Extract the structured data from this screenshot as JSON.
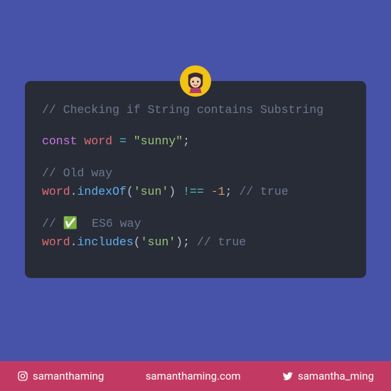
{
  "code": {
    "title_comment": "// Checking if String contains Substring",
    "const_kw": "const",
    "var_name": "word",
    "assign_op": "=",
    "string_value": "\"sunny\"",
    "semicolon": ";",
    "old_comment": "// Old way",
    "dot": ".",
    "indexof_fn": "indexOf",
    "open_paren": "(",
    "arg_sun": "'sun'",
    "close_paren": ")",
    "neq_op": "!==",
    "neg_one": "-1",
    "true_comment": "// true",
    "es6_comment_prefix": "// ",
    "es6_emoji": "✅",
    "es6_comment_suffix": "  ES6 way",
    "includes_fn": "includes"
  },
  "footer": {
    "instagram": "samanthaming",
    "website": "samanthaming.com",
    "twitter": "samantha_ming"
  }
}
